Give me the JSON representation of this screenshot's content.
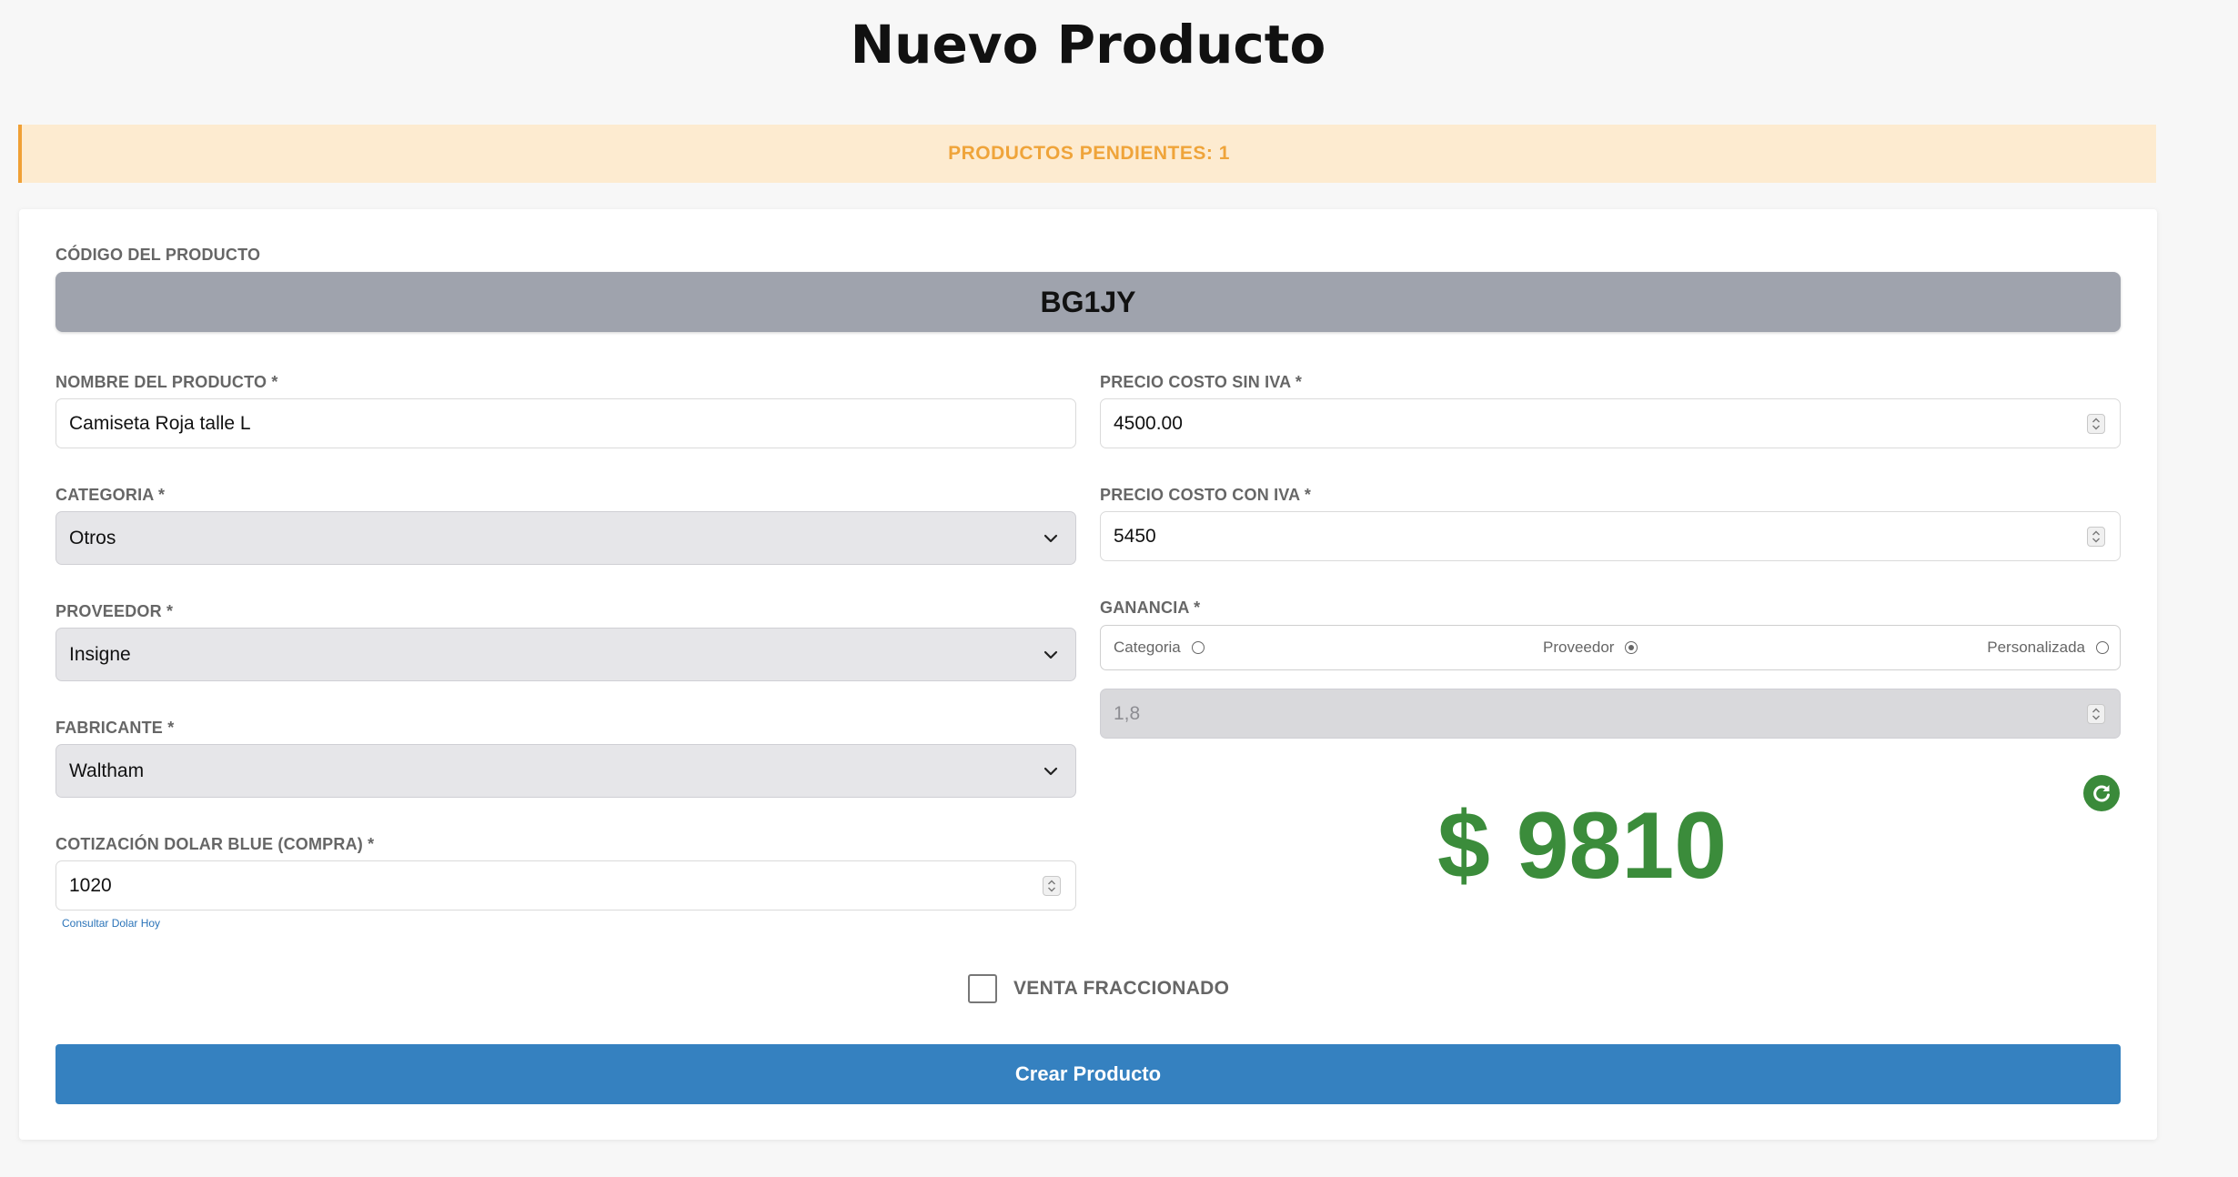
{
  "page": {
    "title": "Nuevo Producto"
  },
  "alert": {
    "text": "PRODUCTOS PENDIENTES: 1"
  },
  "form": {
    "code": {
      "label": "CÓDIGO DEL PRODUCTO",
      "value": "BG1JY"
    },
    "name": {
      "label": "NOMBRE DEL PRODUCTO *",
      "value": "Camiseta Roja talle L"
    },
    "category": {
      "label": "CATEGORIA *",
      "value": "Otros"
    },
    "supplier": {
      "label": "PROVEEDOR *",
      "value": "Insigne"
    },
    "manufacturer": {
      "label": "FABRICANTE *",
      "value": "Waltham"
    },
    "exchange_rate": {
      "label": "COTIZACIÓN DOLAR BLUE (COMPRA) *",
      "value": "1020",
      "link": "Consultar Dolar Hoy"
    },
    "cost_no_tax": {
      "label": "PRECIO COSTO SIN IVA *",
      "value": "4500.00"
    },
    "cost_with_tax": {
      "label": "PRECIO COSTO CON IVA *",
      "value": "5450"
    },
    "profit": {
      "label": "GANANCIA *",
      "options": [
        {
          "label": "Categoria",
          "checked": false
        },
        {
          "label": "Proveedor",
          "checked": true
        },
        {
          "label": "Personalizada",
          "checked": false
        }
      ],
      "value": "1,8"
    },
    "final_price": "$ 9810",
    "fractional_sale": {
      "label": "VENTA FRACCIONADO",
      "checked": false
    },
    "submit_label": "Crear Producto"
  },
  "colors": {
    "accent": "#3581c0",
    "price": "#3b8c3b",
    "alert_bg": "#fdebd0",
    "alert_text": "#efa43a"
  },
  "icons": {
    "select": "chevron-down-icon",
    "number": "spinner-icon",
    "refresh": "refresh-icon"
  }
}
